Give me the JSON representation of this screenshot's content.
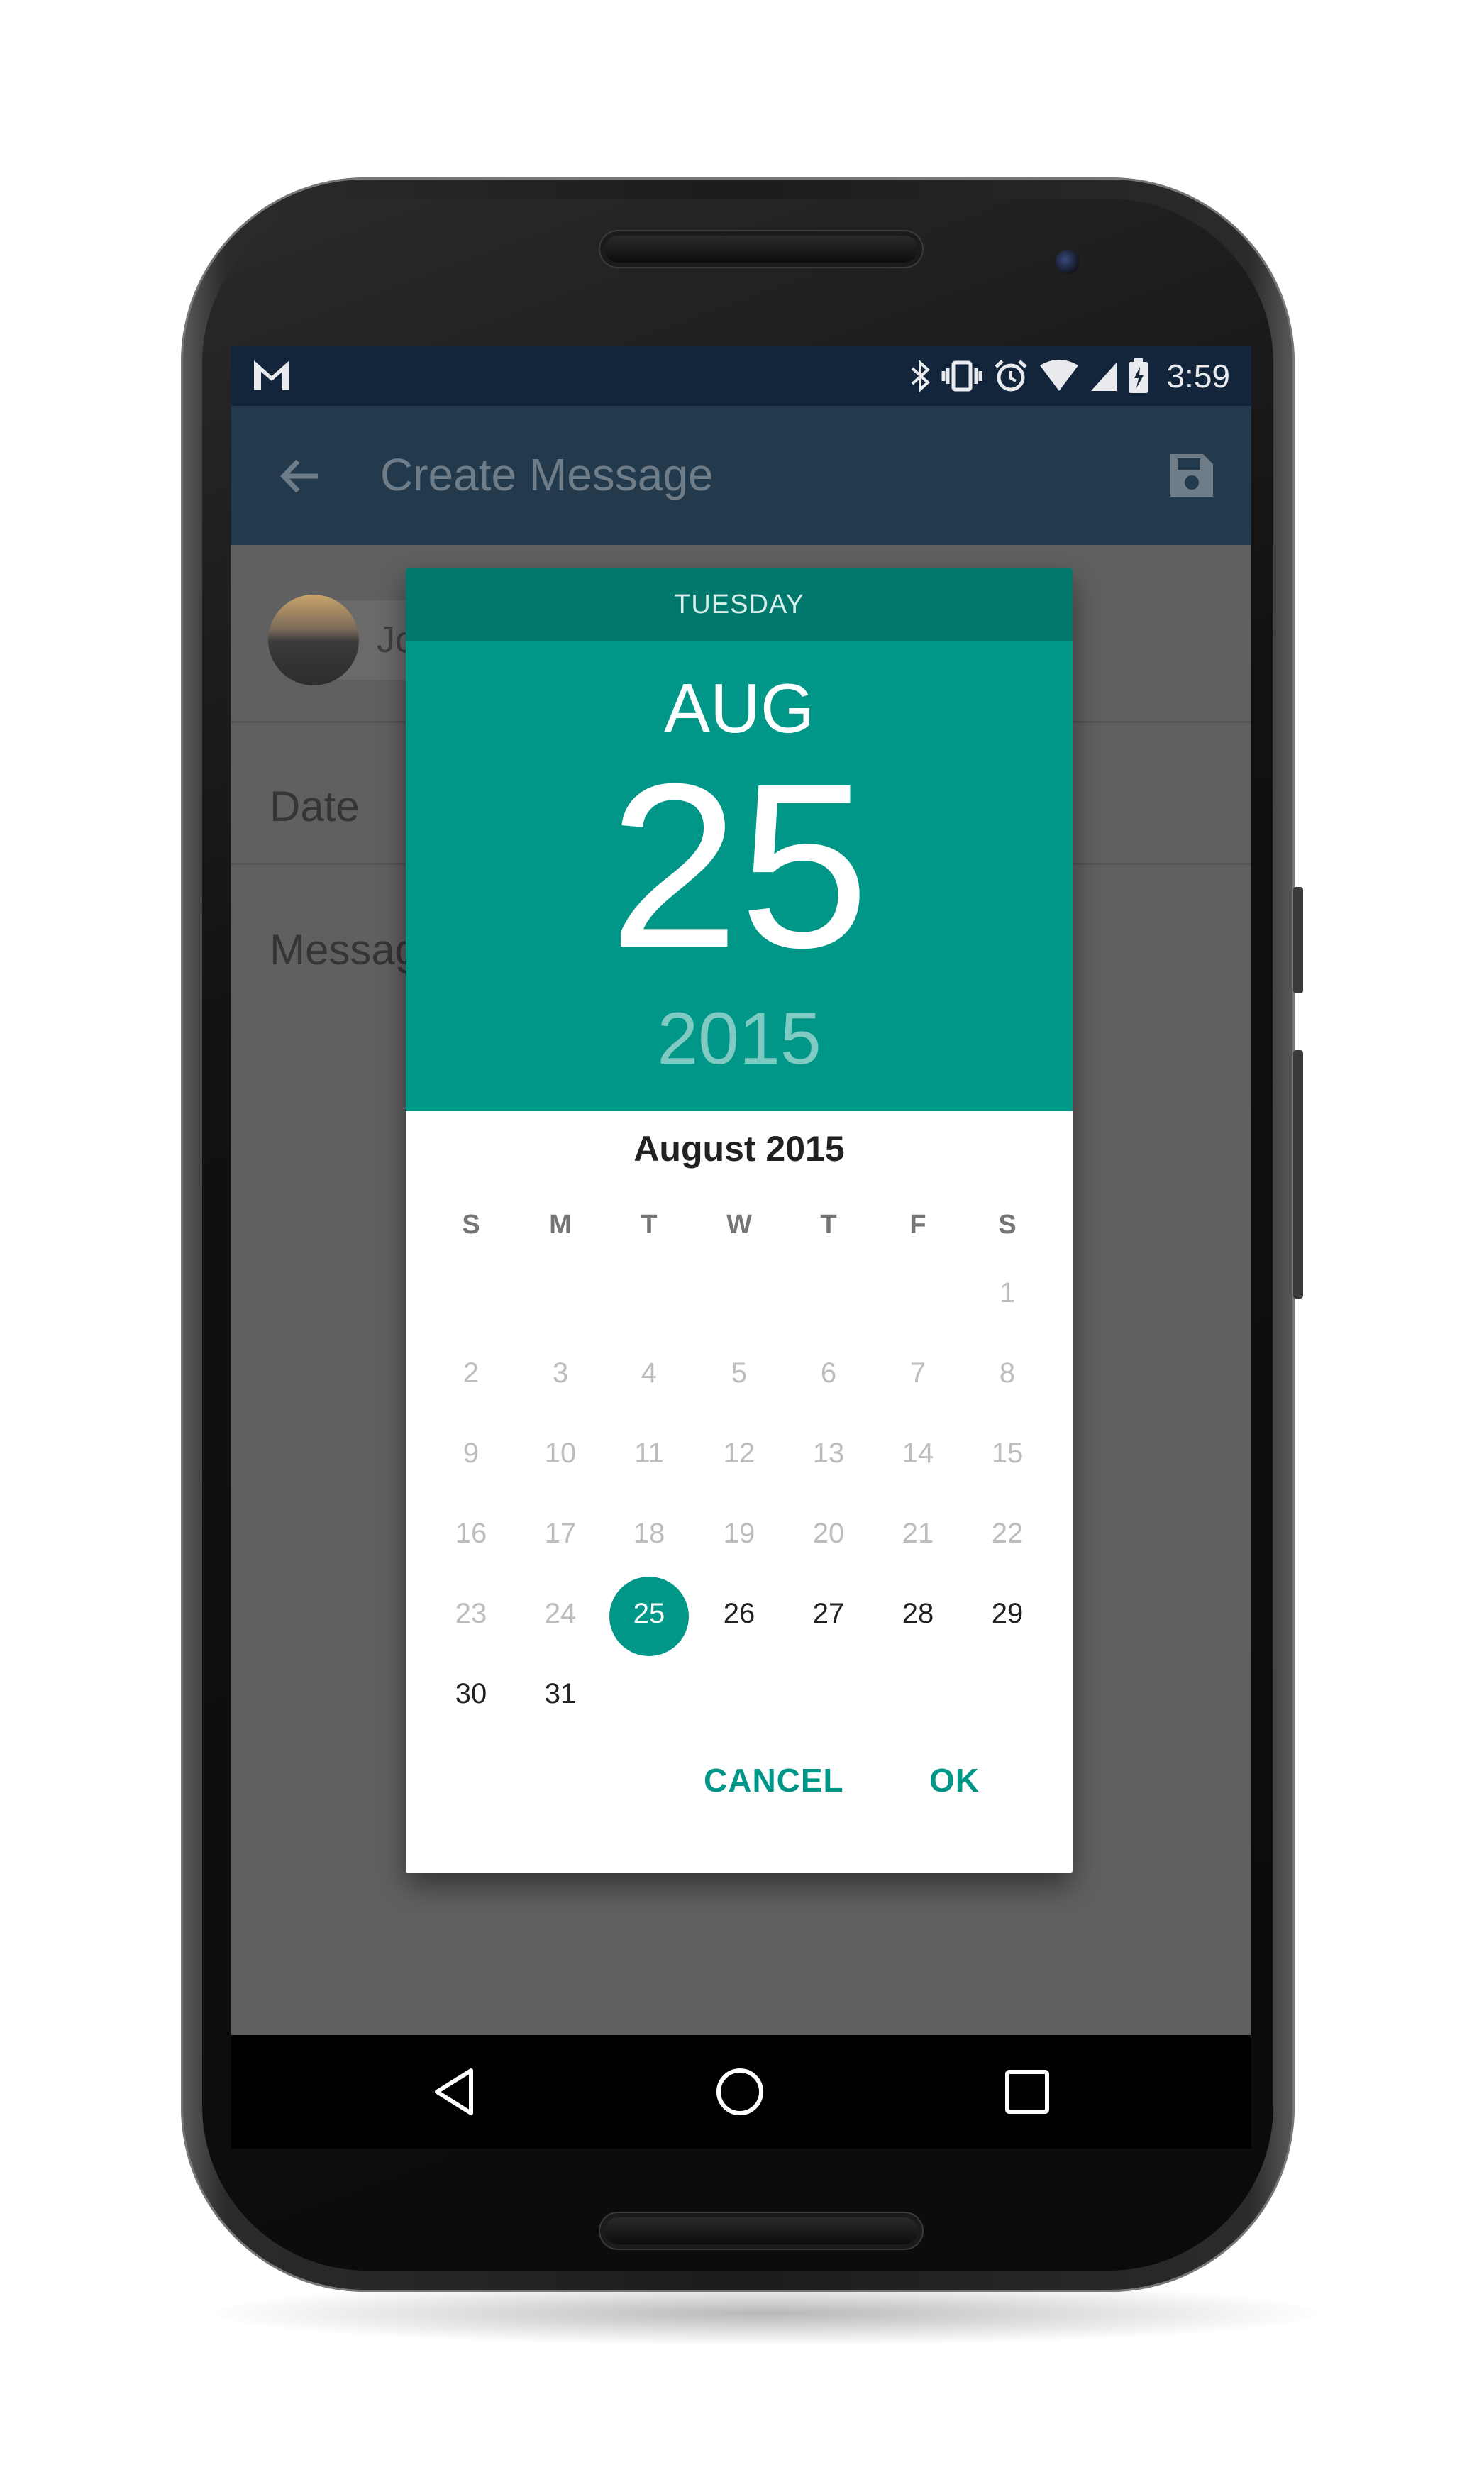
{
  "status_bar": {
    "time": "3:59",
    "icons": [
      "gmail-icon",
      "bluetooth-icon",
      "vibrate-icon",
      "alarm-icon",
      "wifi-icon",
      "signal-icon",
      "battery-icon"
    ]
  },
  "app_bar": {
    "title": "Create Message",
    "back_icon": "arrow-back-icon",
    "save_icon": "save-icon"
  },
  "form": {
    "recipient_chip": "Jo",
    "date_label": "Date",
    "message_label": "Messag"
  },
  "date_picker": {
    "day_of_week": "TUESDAY",
    "month_short": "AUG",
    "date": "25",
    "year": "2015",
    "calendar_title": "August 2015",
    "weekdays": [
      "S",
      "M",
      "T",
      "W",
      "T",
      "F",
      "S"
    ],
    "days": [
      "1",
      "2",
      "3",
      "4",
      "5",
      "6",
      "7",
      "8",
      "9",
      "10",
      "11",
      "12",
      "13",
      "14",
      "15",
      "16",
      "17",
      "18",
      "19",
      "20",
      "21",
      "22",
      "23",
      "24",
      "25",
      "26",
      "27",
      "28",
      "29",
      "30",
      "31"
    ],
    "first_weekday_index": 6,
    "selected_day": 25,
    "cancel_label": "CANCEL",
    "ok_label": "OK"
  },
  "colors": {
    "accent": "#009688",
    "header_dark": "#00786c",
    "year_text": "#7fcbc3",
    "scrim": "#606060"
  },
  "nav_bar": {
    "icons": [
      "back-triangle-icon",
      "home-circle-icon",
      "recents-square-icon"
    ]
  }
}
